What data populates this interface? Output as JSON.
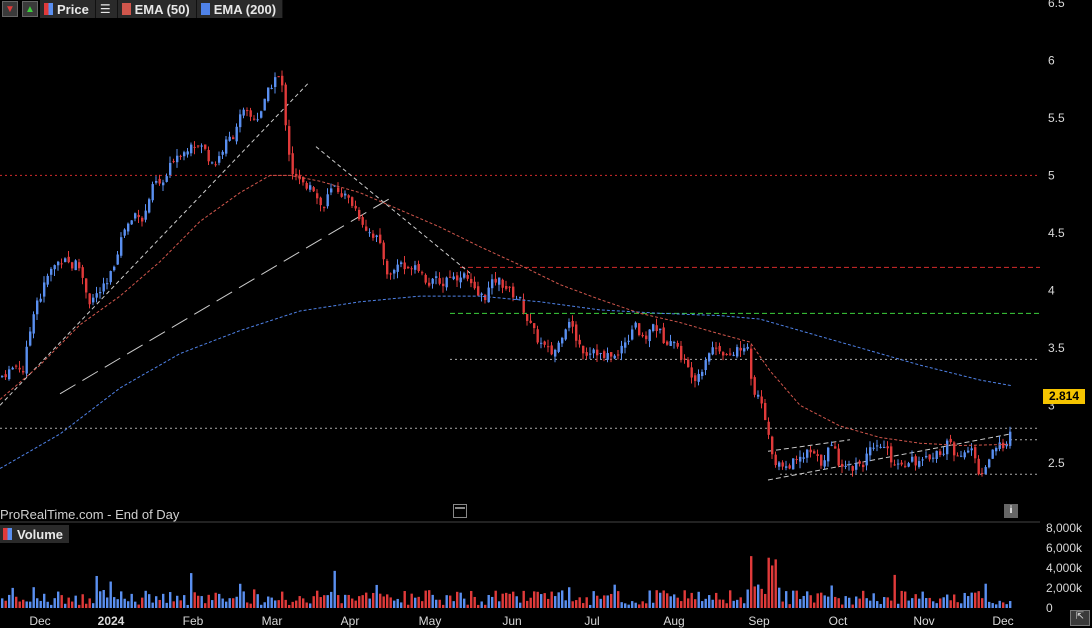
{
  "legend": {
    "price_label": "Price",
    "ema50_label": "EMA (50)",
    "ema200_label": "EMA (200)"
  },
  "watermark": "ProRealTime.com - End of Day",
  "volume_label": "Volume",
  "last_price": "2.814",
  "colors": {
    "up": "#5a8ff0",
    "down": "#e03a3a",
    "ema50": "#d0564c",
    "ema200": "#4f82e8",
    "resistance_red": "#d42b2b",
    "support_green": "#3ccf3c",
    "price_tag": "#f5c400"
  },
  "chart_data": [
    {
      "type": "candlestick",
      "x_ticks": [
        "Dec",
        "2024",
        "Feb",
        "Mar",
        "Apr",
        "May",
        "Jun",
        "Jul",
        "Aug",
        "Sep",
        "Oct",
        "Nov",
        "Dec"
      ],
      "y_ticks": [
        "6.5",
        "6",
        "5.5",
        "5",
        "4.5",
        "4",
        "3.5",
        "3",
        "2.5"
      ],
      "ylim": [
        2.3,
        6.5
      ],
      "price_path": [
        [
          0,
          3.25
        ],
        [
          8,
          3.3
        ],
        [
          16,
          3.35
        ],
        [
          22,
          3.3
        ],
        [
          28,
          3.6
        ],
        [
          34,
          3.9
        ],
        [
          40,
          3.95
        ],
        [
          45,
          4.1
        ],
        [
          52,
          4.2
        ],
        [
          58,
          4.25
        ],
        [
          64,
          4.3
        ],
        [
          70,
          4.2
        ],
        [
          76,
          4.25
        ],
        [
          82,
          4.1
        ],
        [
          88,
          3.9
        ],
        [
          94,
          3.95
        ],
        [
          100,
          4.0
        ],
        [
          106,
          4.05
        ],
        [
          112,
          4.2
        ],
        [
          118,
          4.4
        ],
        [
          124,
          4.55
        ],
        [
          130,
          4.6
        ],
        [
          136,
          4.7
        ],
        [
          142,
          4.6
        ],
        [
          148,
          4.8
        ],
        [
          154,
          4.95
        ],
        [
          160,
          4.9
        ],
        [
          166,
          5.0
        ],
        [
          172,
          5.15
        ],
        [
          178,
          5.2
        ],
        [
          184,
          5.2
        ],
        [
          190,
          5.3
        ],
        [
          196,
          5.25
        ],
        [
          202,
          5.25
        ],
        [
          208,
          5.15
        ],
        [
          214,
          5.1
        ],
        [
          220,
          5.2
        ],
        [
          226,
          5.3
        ],
        [
          232,
          5.35
        ],
        [
          238,
          5.5
        ],
        [
          244,
          5.55
        ],
        [
          250,
          5.5
        ],
        [
          256,
          5.5
        ],
        [
          262,
          5.6
        ],
        [
          268,
          5.75
        ],
        [
          274,
          5.85
        ],
        [
          280,
          5.85
        ],
        [
          284,
          5.5
        ],
        [
          288,
          5.2
        ],
        [
          292,
          5.0
        ],
        [
          298,
          4.95
        ],
        [
          304,
          4.9
        ],
        [
          310,
          4.95
        ],
        [
          316,
          4.8
        ],
        [
          322,
          4.7
        ],
        [
          328,
          4.85
        ],
        [
          334,
          4.9
        ],
        [
          340,
          4.85
        ],
        [
          346,
          4.8
        ],
        [
          352,
          4.75
        ],
        [
          358,
          4.65
        ],
        [
          364,
          4.55
        ],
        [
          370,
          4.5
        ],
        [
          376,
          4.45
        ],
        [
          382,
          4.3
        ],
        [
          388,
          4.1
        ],
        [
          394,
          4.2
        ],
        [
          400,
          4.25
        ],
        [
          406,
          4.15
        ],
        [
          412,
          4.25
        ],
        [
          418,
          4.2
        ],
        [
          424,
          4.1
        ],
        [
          430,
          4.05
        ],
        [
          436,
          4.1
        ],
        [
          442,
          4.05
        ],
        [
          448,
          4.15
        ],
        [
          454,
          4.1
        ],
        [
          460,
          4.15
        ],
        [
          466,
          4.1
        ],
        [
          472,
          4.0
        ],
        [
          478,
          3.95
        ],
        [
          484,
          3.95
        ],
        [
          490,
          4.05
        ],
        [
          496,
          4.1
        ],
        [
          502,
          4.05
        ],
        [
          508,
          4.0
        ],
        [
          514,
          3.95
        ],
        [
          520,
          3.9
        ],
        [
          526,
          3.75
        ],
        [
          532,
          3.65
        ],
        [
          538,
          3.55
        ],
        [
          544,
          3.5
        ],
        [
          550,
          3.45
        ],
        [
          556,
          3.5
        ],
        [
          562,
          3.65
        ],
        [
          568,
          3.75
        ],
        [
          574,
          3.6
        ],
        [
          580,
          3.5
        ],
        [
          586,
          3.45
        ],
        [
          592,
          3.5
        ],
        [
          598,
          3.45
        ],
        [
          604,
          3.4
        ],
        [
          610,
          3.45
        ],
        [
          616,
          3.4
        ],
        [
          622,
          3.55
        ],
        [
          628,
          3.6
        ],
        [
          634,
          3.75
        ],
        [
          640,
          3.55
        ],
        [
          646,
          3.6
        ],
        [
          652,
          3.7
        ],
        [
          658,
          3.65
        ],
        [
          664,
          3.55
        ],
        [
          670,
          3.6
        ],
        [
          676,
          3.5
        ],
        [
          682,
          3.4
        ],
        [
          688,
          3.3
        ],
        [
          694,
          3.25
        ],
        [
          700,
          3.3
        ],
        [
          706,
          3.45
        ],
        [
          712,
          3.5
        ],
        [
          718,
          3.5
        ],
        [
          724,
          3.45
        ],
        [
          730,
          3.4
        ],
        [
          736,
          3.5
        ],
        [
          742,
          3.45
        ],
        [
          746,
          3.55
        ],
        [
          750,
          3.2
        ],
        [
          754,
          3.05
        ],
        [
          758,
          3.1
        ],
        [
          762,
          3.0
        ],
        [
          766,
          2.8
        ],
        [
          770,
          2.6
        ],
        [
          774,
          2.45
        ],
        [
          778,
          2.5
        ],
        [
          784,
          2.45
        ],
        [
          790,
          2.5
        ],
        [
          796,
          2.5
        ],
        [
          802,
          2.55
        ],
        [
          808,
          2.6
        ],
        [
          814,
          2.55
        ],
        [
          820,
          2.5
        ],
        [
          826,
          2.6
        ],
        [
          832,
          2.65
        ],
        [
          838,
          2.5
        ],
        [
          844,
          2.5
        ],
        [
          850,
          2.45
        ],
        [
          856,
          2.5
        ],
        [
          862,
          2.5
        ],
        [
          868,
          2.6
        ],
        [
          874,
          2.6
        ],
        [
          880,
          2.65
        ],
        [
          886,
          2.6
        ],
        [
          892,
          2.5
        ],
        [
          898,
          2.5
        ],
        [
          904,
          2.5
        ],
        [
          910,
          2.55
        ],
        [
          916,
          2.5
        ],
        [
          922,
          2.5
        ],
        [
          928,
          2.55
        ],
        [
          934,
          2.6
        ],
        [
          940,
          2.55
        ],
        [
          946,
          2.7
        ],
        [
          952,
          2.6
        ],
        [
          958,
          2.6
        ],
        [
          964,
          2.55
        ],
        [
          970,
          2.65
        ],
        [
          976,
          2.45
        ],
        [
          982,
          2.4
        ],
        [
          988,
          2.55
        ],
        [
          994,
          2.6
        ],
        [
          1000,
          2.65
        ],
        [
          1006,
          2.7
        ],
        [
          1012,
          2.814
        ]
      ],
      "ema50": [
        [
          0,
          3.05
        ],
        [
          40,
          3.35
        ],
        [
          80,
          3.7
        ],
        [
          120,
          3.95
        ],
        [
          160,
          4.25
        ],
        [
          200,
          4.6
        ],
        [
          240,
          4.85
        ],
        [
          270,
          5.0
        ],
        [
          290,
          5.0
        ],
        [
          320,
          4.95
        ],
        [
          360,
          4.85
        ],
        [
          400,
          4.7
        ],
        [
          440,
          4.55
        ],
        [
          480,
          4.38
        ],
        [
          520,
          4.22
        ],
        [
          560,
          4.05
        ],
        [
          600,
          3.92
        ],
        [
          640,
          3.8
        ],
        [
          680,
          3.72
        ],
        [
          720,
          3.62
        ],
        [
          750,
          3.55
        ],
        [
          770,
          3.3
        ],
        [
          800,
          3.0
        ],
        [
          840,
          2.82
        ],
        [
          880,
          2.72
        ],
        [
          920,
          2.67
        ],
        [
          960,
          2.65
        ],
        [
          1010,
          2.66
        ]
      ],
      "ema200": [
        [
          0,
          2.45
        ],
        [
          60,
          2.75
        ],
        [
          120,
          3.15
        ],
        [
          180,
          3.45
        ],
        [
          240,
          3.65
        ],
        [
          300,
          3.82
        ],
        [
          360,
          3.9
        ],
        [
          420,
          3.95
        ],
        [
          480,
          3.95
        ],
        [
          540,
          3.9
        ],
        [
          600,
          3.83
        ],
        [
          660,
          3.8
        ],
        [
          720,
          3.78
        ],
        [
          760,
          3.75
        ],
        [
          800,
          3.65
        ],
        [
          860,
          3.5
        ],
        [
          920,
          3.35
        ],
        [
          980,
          3.22
        ],
        [
          1012,
          3.17
        ]
      ],
      "hlines": [
        {
          "y": 5.0,
          "style": "dotted",
          "color": "#d42b2b",
          "x0": 0,
          "x1": 1040
        },
        {
          "y": 4.2,
          "style": "dashed",
          "color": "#d42b2b",
          "x0": 460,
          "x1": 1040
        },
        {
          "y": 3.8,
          "style": "dashed",
          "color": "#3ccf3c",
          "x0": 450,
          "x1": 1040
        },
        {
          "y": 3.4,
          "style": "dotted",
          "color": "#aaaaaa",
          "x0": 450,
          "x1": 1040
        },
        {
          "y": 2.8,
          "style": "dotted",
          "color": "#aaaaaa",
          "x0": 0,
          "x1": 1040
        },
        {
          "y": 2.7,
          "style": "dotted",
          "color": "#aaaaaa",
          "x0": 1010,
          "x1": 1040
        },
        {
          "y": 2.4,
          "style": "dotted",
          "color": "#aaaaaa",
          "x0": 780,
          "x1": 1040
        }
      ],
      "trendlines": [
        {
          "p": [
            [
              0,
              3.0
            ],
            [
              308,
              5.8
            ]
          ],
          "dash": "4,3",
          "color": "#cccccc"
        },
        {
          "p": [
            [
              60,
              3.1
            ],
            [
              390,
              4.8
            ]
          ],
          "dash": "18,8",
          "color": "#cccccc"
        },
        {
          "p": [
            [
              316,
              5.25
            ],
            [
              470,
              4.15
            ]
          ],
          "dash": "4,3",
          "color": "#cccccc"
        },
        {
          "p": [
            [
              768,
              2.6
            ],
            [
              850,
              2.7
            ]
          ],
          "dash": "5,3",
          "color": "#cccccc"
        },
        {
          "p": [
            [
              768,
              2.35
            ],
            [
              1010,
              2.75
            ]
          ],
          "dash": "5,3",
          "color": "#cccccc"
        }
      ]
    },
    {
      "type": "bar",
      "title": "Volume",
      "y_ticks": [
        "8,000k",
        "6,000k",
        "4,000k",
        "2,000k",
        "0"
      ],
      "ylim": [
        0,
        8000
      ]
    }
  ]
}
